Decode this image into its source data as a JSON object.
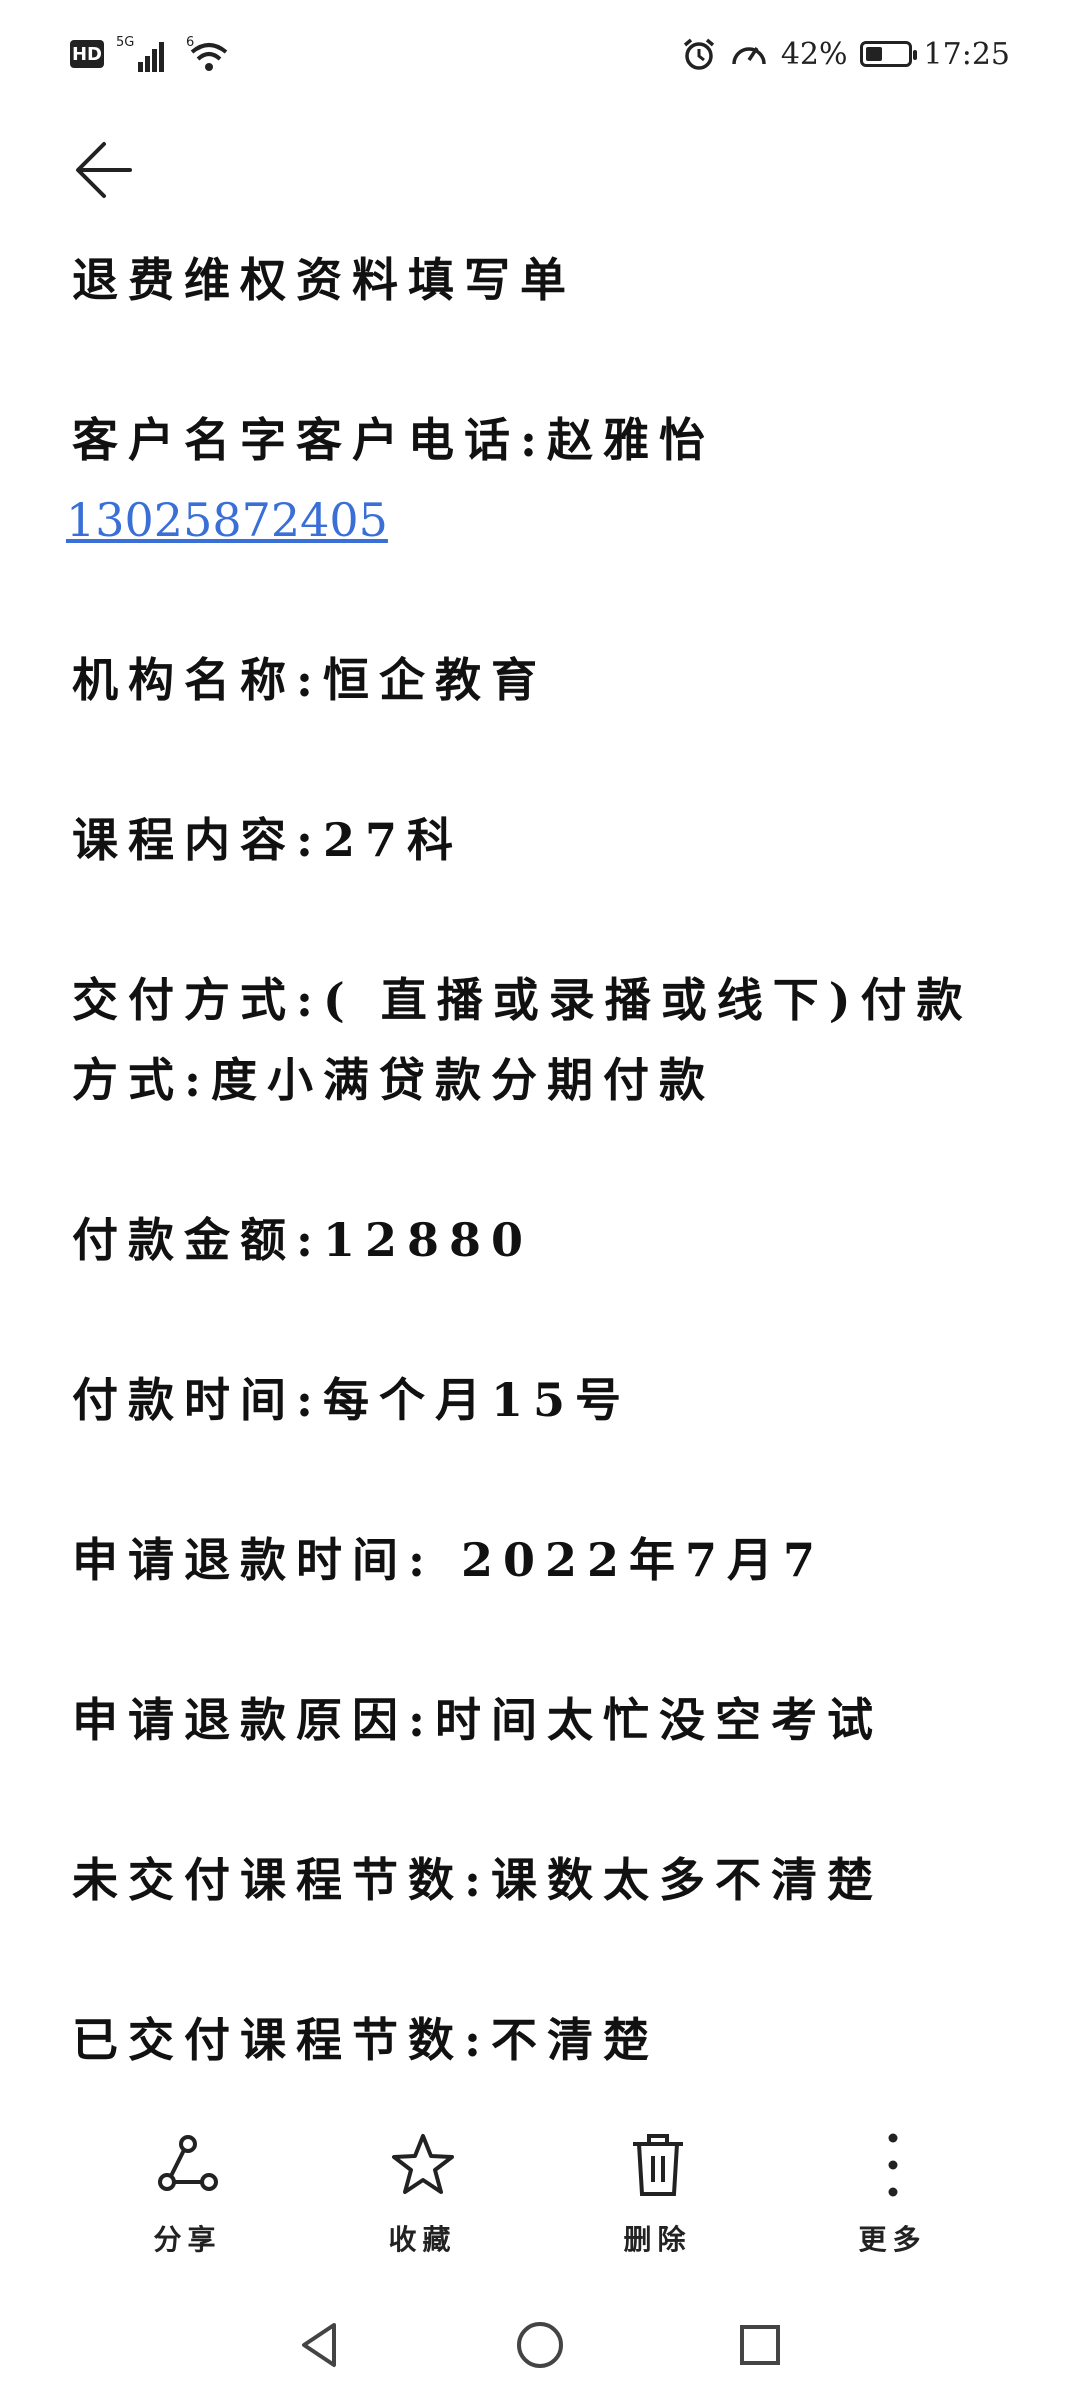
{
  "status_bar": {
    "hd": "HD",
    "network": "5G",
    "wifi_badge": "6",
    "battery_percent": "42%",
    "battery_level": 0.42,
    "time": "17:25",
    "icons": [
      "alarm-icon",
      "speedometer-icon",
      "battery-icon",
      "signal-icon",
      "wifi-icon"
    ]
  },
  "note": {
    "title": "退费维权资料填写单",
    "customer": "客户名字客户电话:赵雅怡",
    "phone": "13025872405",
    "org": "机构名称:恒企教育",
    "course": "课程内容:27科",
    "delivery": "交付方式:( 直播或录播或线下)付款方式:度小满贷款分期付款",
    "amount": "付款金额:12880",
    "pay_time": "付款时间:每个月15号",
    "refund_time": "申请退款时间: 2022年7月7",
    "refund_reason": "申请退款原因:时间太忙没空考试",
    "undelivered": "未交付课程节数:课数太多不清楚",
    "delivered": "已交付课程节数:不清楚"
  },
  "actions": {
    "share": "分享",
    "favorite": "收藏",
    "delete": "删除",
    "more": "更多"
  },
  "colors": {
    "link": "#3a6fd8",
    "text": "#111111",
    "background": "#ffffff"
  }
}
